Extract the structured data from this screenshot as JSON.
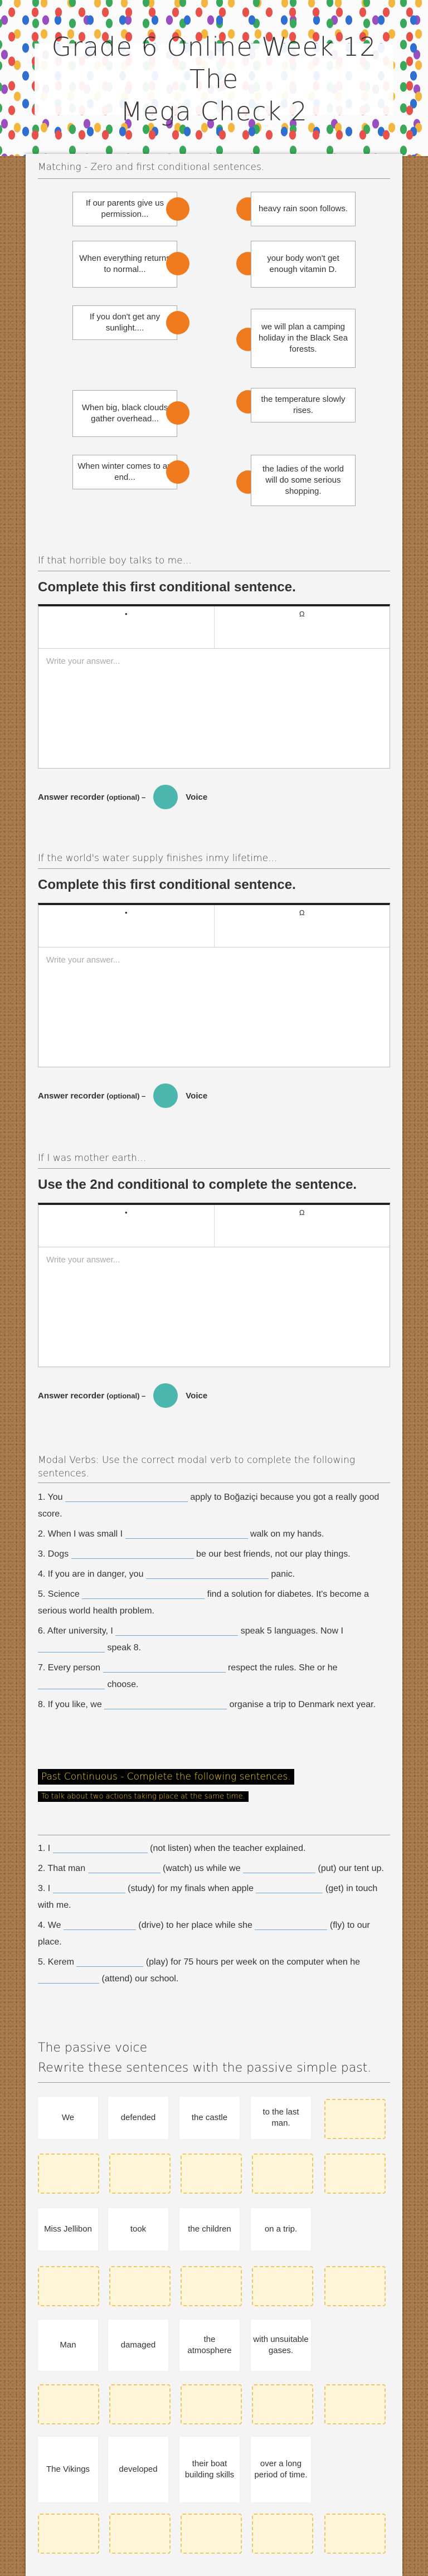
{
  "title": {
    "line1": "Grade 6 Online Week 12 The",
    "line2": "Mega Check 2"
  },
  "matching": {
    "heading": "Matching - Zero and first conditional sentences.",
    "left": [
      "If our parents give us permission...",
      "When everything returns to normal...",
      "If you don't get any sunlight....",
      "When big, black clouds gather overhead...",
      "When winter comes to an end..."
    ],
    "right": [
      "heavy rain soon follows.",
      "your body won't get enough vitamin D.",
      "we will plan a camping holiday in the Black Sea forests.",
      "the temperature slowly rises.",
      "the ladies of the world will do some serious shopping."
    ]
  },
  "questions": [
    {
      "prompt": "If that horrible boy talks to me...",
      "title": "Complete this first conditional sentence.",
      "placeholder": "Write your answer...",
      "tools": [
        "•",
        "Ω"
      ]
    },
    {
      "prompt": "If the world's water supply finishes inmy lifetime...",
      "title": "Complete this first conditional sentence.",
      "placeholder": "Write your answer...",
      "tools": [
        "•",
        "Ω"
      ]
    },
    {
      "prompt": "If I was mother earth...",
      "title": "Use the 2nd conditional to complete the sentence.",
      "placeholder": "Write your answer...",
      "tools": [
        "•",
        "Ω"
      ]
    }
  ],
  "recorder": {
    "label": "Answer recorder",
    "optional": "(optional) –",
    "voice": "Voice"
  },
  "modal": {
    "heading": "Modal Verbs: Use the correct modal verb to complete the following sentences.",
    "items": [
      [
        "1. You",
        "apply to Boğaziçi because you got a really good score."
      ],
      [
        "2. When I was small I",
        "walk on my hands."
      ],
      [
        "3. Dogs",
        "be our best friends, not our play things."
      ],
      [
        "4. If you are in danger, you",
        "panic."
      ],
      [
        "5. Science",
        "find a solution for diabetes. It's become a serious world health problem."
      ],
      [
        "6. After university, I",
        "speak 5 languages. Now I",
        "speak 8."
      ],
      [
        "7. Every person",
        "respect the rules. She or he",
        "choose."
      ],
      [
        "8. If you like, we",
        "organise a trip to Denmark next year."
      ]
    ]
  },
  "past_continuous": {
    "heading": "Past Continuous - Complete the following sentences.",
    "subheading": "To talk about two actions taking place at the same time.",
    "items": [
      [
        "1. I",
        "(not listen) when the teacher explained."
      ],
      [
        "2. That man",
        "(watch) us while we",
        "(put) our tent up."
      ],
      [
        "3. I",
        "(study) for my finals when apple",
        "(get) in touch with me."
      ],
      [
        "4. We",
        "(drive) to her place while she",
        "(fly) to our place."
      ],
      [
        "5. Kerem",
        "(play) for 75 hours per week on the computer when he",
        "(attend) our school."
      ]
    ]
  },
  "passive": {
    "heading": "The passive voice",
    "subheading": "Rewrite these sentences with the passive simple past.",
    "rows": [
      [
        "We",
        "defended",
        "the castle",
        "to the last man."
      ],
      [
        "Miss Jellibon",
        "took",
        "the children",
        "on a trip."
      ],
      [
        "Man",
        "damaged",
        "the atmosphere",
        "with unsuitable gases."
      ],
      [
        "The Vikings",
        "developed",
        "their boat building skills",
        "over a long period of time."
      ]
    ]
  }
}
